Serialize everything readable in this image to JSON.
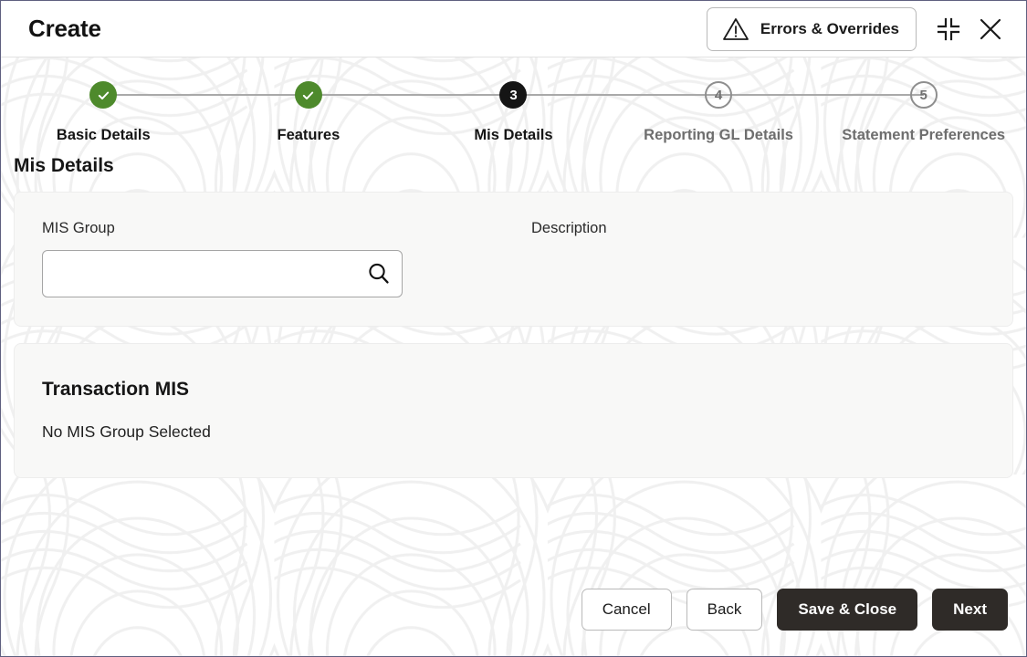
{
  "window": {
    "title": "Create",
    "errors_button": {
      "label": "Errors & Overrides",
      "icon": "warning-triangle-icon"
    },
    "minimize_icon": "collapse-icon",
    "close_icon": "close-icon"
  },
  "stepper": {
    "current_step": 3,
    "steps": [
      {
        "number": "1",
        "label": "Basic Details",
        "state": "done",
        "marker": "✓"
      },
      {
        "number": "2",
        "label": "Features",
        "state": "done",
        "marker": "✓"
      },
      {
        "number": "3",
        "label": "Mis Details",
        "state": "current",
        "marker": "3"
      },
      {
        "number": "4",
        "label": "Reporting GL Details",
        "state": "todo",
        "marker": "4"
      },
      {
        "number": "5",
        "label": "Statement Preferences",
        "state": "todo",
        "marker": "5"
      }
    ]
  },
  "main": {
    "section_title": "Mis Details",
    "mis_group_card": {
      "mis_group_label": "MIS Group",
      "mis_group_value": "",
      "mis_group_placeholder": "",
      "search_icon": "search-icon",
      "description_label": "Description",
      "description_value": ""
    },
    "transaction_card": {
      "title": "Transaction MIS",
      "empty_text": "No MIS Group Selected"
    }
  },
  "footer": {
    "cancel_label": "Cancel",
    "back_label": "Back",
    "save_close_label": "Save & Close",
    "next_label": "Next"
  },
  "colors": {
    "step_done": "#4e8a2c",
    "step_current": "#151515",
    "step_todo_outline": "#8e8e8e",
    "connector": "#a9a9a9",
    "primary_button": "#2f2b28",
    "card_background": "#f8f8f7",
    "window_border": "#5f6080"
  }
}
